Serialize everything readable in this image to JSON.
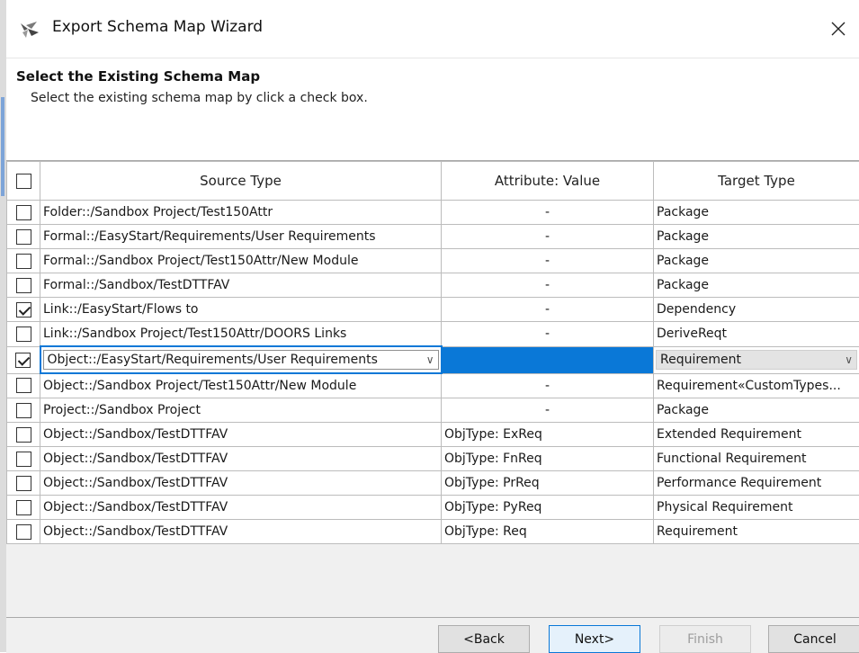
{
  "window": {
    "title": "Export Schema Map Wizard"
  },
  "header": {
    "title": "Select the Existing Schema Map",
    "subtitle": "Select the existing schema map by click a check box."
  },
  "table": {
    "columns": [
      "Source Type",
      "Attribute: Value",
      "Target Type"
    ],
    "select_all_checked": false,
    "rows": [
      {
        "checked": false,
        "source": "Folder::/Sandbox Project/Test150Attr",
        "attr": "-",
        "target": "Package"
      },
      {
        "checked": false,
        "source": "Formal::/EasyStart/Requirements/User Requirements",
        "attr": "-",
        "target": "Package"
      },
      {
        "checked": false,
        "source": "Formal::/Sandbox Project/Test150Attr/New Module",
        "attr": "-",
        "target": "Package"
      },
      {
        "checked": false,
        "source": "Formal::/Sandbox/TestDTTFAV",
        "attr": "-",
        "target": "Package"
      },
      {
        "checked": true,
        "source": "Link::/EasyStart/Flows to",
        "attr": "-",
        "target": "Dependency"
      },
      {
        "checked": false,
        "source": "Link::/Sandbox Project/Test150Attr/DOORS Links",
        "attr": "-",
        "target": "DeriveReqt"
      },
      {
        "checked": true,
        "source": "Object::/EasyStart/Requirements/User Requirements",
        "attr": "-",
        "target": "Requirement",
        "editing": true
      },
      {
        "checked": false,
        "source": "Object::/Sandbox Project/Test150Attr/New Module",
        "attr": "-",
        "target": "Requirement«CustomTypes..."
      },
      {
        "checked": false,
        "source": "Project::/Sandbox Project",
        "attr": "-",
        "target": "Package"
      },
      {
        "checked": false,
        "source": "Object::/Sandbox/TestDTTFAV",
        "attr": "ObjType: ExReq",
        "target": "Extended Requirement"
      },
      {
        "checked": false,
        "source": "Object::/Sandbox/TestDTTFAV",
        "attr": "ObjType: FnReq",
        "target": "Functional Requirement"
      },
      {
        "checked": false,
        "source": "Object::/Sandbox/TestDTTFAV",
        "attr": "ObjType: PrReq",
        "target": "Performance Requirement"
      },
      {
        "checked": false,
        "source": "Object::/Sandbox/TestDTTFAV",
        "attr": "ObjType: PyReq",
        "target": "Physical Requirement"
      },
      {
        "checked": false,
        "source": "Object::/Sandbox/TestDTTFAV",
        "attr": "ObjType: Req",
        "target": "Requirement"
      }
    ]
  },
  "buttons": {
    "back": "<Back",
    "next": "Next>",
    "finish": "Finish",
    "cancel": "Cancel"
  },
  "colors": {
    "selection": "#0a78d7",
    "chrome": "#f0f0f0"
  },
  "icons": {
    "app": "wizard-app-icon",
    "close": "close-icon",
    "dropdown": "chevron-down-icon"
  }
}
